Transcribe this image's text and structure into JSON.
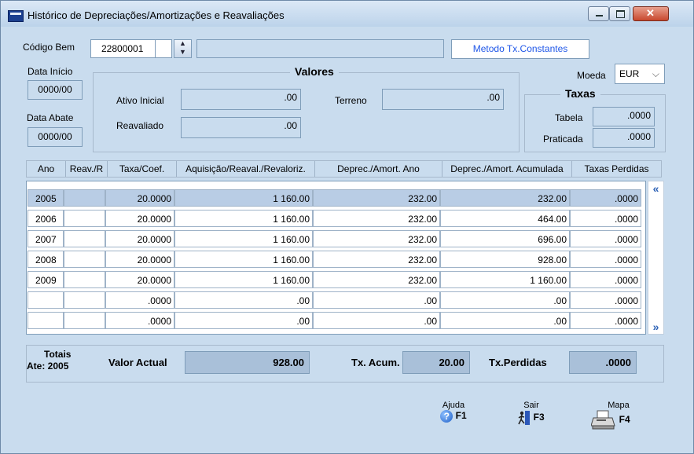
{
  "window": {
    "title": "Histórico de Depreciações/Amortizações e Reavaliações"
  },
  "header": {
    "codigo_bem_label": "Código Bem",
    "codigo_bem_value": "22800001",
    "sub_code_value": "",
    "description_value": "",
    "metodo_button": "Metodo Tx.Constantes",
    "data_inicio_label": "Data Início",
    "data_inicio_value": "0000/00",
    "data_abate_label": "Data Abate",
    "data_abate_value": "0000/00",
    "moeda_label": "Moeda",
    "moeda_value": "EUR"
  },
  "valores": {
    "title": "Valores",
    "ativo_inicial_label": "Ativo Inicial",
    "ativo_inicial_value": ".00",
    "reavaliado_label": "Reavaliado",
    "reavaliado_value": ".00",
    "terreno_label": "Terreno",
    "terreno_value": ".00"
  },
  "taxas": {
    "title": "Taxas",
    "tabela_label": "Tabela",
    "tabela_value": ".0000",
    "praticada_label": "Praticada",
    "praticada_value": ".0000"
  },
  "grid": {
    "columns": [
      "Ano",
      "Reav./R",
      "Taxa/Coef.",
      "Aquisição/Reaval./Revaloriz.",
      "Deprec./Amort. Ano",
      "Deprec./Amort. Acumulada",
      "Taxas Perdidas"
    ],
    "rows": [
      [
        "2005",
        "",
        "20.0000",
        "1 160.00",
        "232.00",
        "232.00",
        ".0000"
      ],
      [
        "2006",
        "",
        "20.0000",
        "1 160.00",
        "232.00",
        "464.00",
        ".0000"
      ],
      [
        "2007",
        "",
        "20.0000",
        "1 160.00",
        "232.00",
        "696.00",
        ".0000"
      ],
      [
        "2008",
        "",
        "20.0000",
        "1 160.00",
        "232.00",
        "928.00",
        ".0000"
      ],
      [
        "2009",
        "",
        "20.0000",
        "1 160.00",
        "232.00",
        "1 160.00",
        ".0000"
      ],
      [
        "",
        "",
        ".0000",
        ".00",
        ".00",
        ".00",
        ".0000"
      ],
      [
        "",
        "",
        ".0000",
        ".00",
        ".00",
        ".00",
        ".0000"
      ]
    ],
    "scroll_up": "«",
    "scroll_down": "»"
  },
  "totals": {
    "label_line1": "Totais",
    "label_line2": "Ate: 2005",
    "valor_actual_label": "Valor Actual",
    "valor_actual_value": "928.00",
    "tx_acum_label": "Tx. Acum.",
    "tx_acum_value": "20.00",
    "tx_perdidas_label": "Tx.Perdidas",
    "tx_perdidas_value": ".0000"
  },
  "footer": {
    "ajuda_label": "Ajuda",
    "ajuda_key": "F1",
    "sair_label": "Sair",
    "sair_key": "F3",
    "mapa_label": "Mapa",
    "mapa_key": "F4"
  },
  "icons": {
    "app": "app-icon",
    "minimize": "minimize-icon",
    "maximize": "maximize-icon",
    "close": "close-icon",
    "help": "help-icon",
    "exit": "exit-icon",
    "print": "printer-icon"
  }
}
